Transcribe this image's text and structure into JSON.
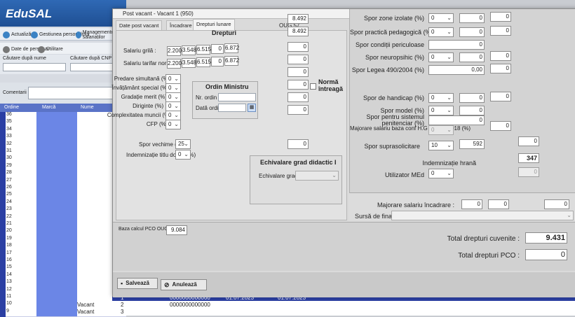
{
  "app": {
    "logo": "EduSAL",
    "nav": [
      "Actualizări",
      "Gestiunea personalului",
      "Managementul salariaților"
    ],
    "row2": [
      "Date de personal",
      "Utilitare"
    ],
    "search_name_label": "Căutare după nume",
    "search_cnp_label": "Căutare după CNP",
    "comments_label": "Comentarii",
    "grid_headers": [
      "Ordine",
      "Marcă",
      "Nume"
    ],
    "grid_rows": [
      "36",
      "35",
      "34",
      "33",
      "32",
      "31",
      "30",
      "29",
      "28",
      "27",
      "26",
      "25",
      "24",
      "23",
      "22",
      "21",
      "20",
      "19",
      "18",
      "17",
      "16",
      "15",
      "14",
      "13",
      "12",
      "11",
      "10",
      "9"
    ],
    "bottom_rows": [
      {
        "status": "Vacant",
        "nr": "1",
        "code": "0000000000000",
        "date": "01.07.2023",
        "date2": "01.07.2023"
      },
      {
        "status": "Vacant",
        "nr": "2",
        "code": "0000000000000",
        "date": "",
        "date2": ""
      },
      {
        "status": "Vacant",
        "nr": "3",
        "code": "",
        "date": "",
        "date2": ""
      }
    ]
  },
  "modal": {
    "title": "Post vacant - Vacant 1 (950)",
    "tabs": [
      "Date post vacant",
      "Încadrare",
      "Drepturi lunare"
    ],
    "drepturi_header": "Drepturi",
    "oug_header": "OUG 57",
    "oug_values": [
      "8.492",
      "8.492"
    ],
    "salariu_grila_label": "Salariu grilă :",
    "salariu_grila_values": [
      "2.200",
      "3.548",
      "6.515",
      "0",
      "6.872"
    ],
    "salariu_tarifar_label": "Salariu tarifar normat :",
    "salariu_tarifar_values": [
      "2.200",
      "3.548",
      "6.515",
      "0",
      "6.872"
    ],
    "left_fields": [
      {
        "label": "Predare simultană (%)",
        "value": "0"
      },
      {
        "label": "Învățământ special (%)",
        "value": "0"
      },
      {
        "label": "Gradație merit (%)",
        "value": "0"
      },
      {
        "label": "Diriginte (%)",
        "value": "0"
      },
      {
        "label": "Complexitatea muncii (%)",
        "value": "0"
      },
      {
        "label": "CFP (%)",
        "value": "0"
      }
    ],
    "oug_small_values": [
      "0",
      "0",
      "0",
      "0",
      "0",
      "0",
      "0",
      "0"
    ],
    "norma_label": "Normă întreagă",
    "ordin_title": "Ordin Ministru",
    "nr_ordin_label": "Nr. ordin",
    "data_ordin_label": "Dată ordin",
    "spor_vechime_label": "Spor vechime (%)",
    "spor_vechime_value": "25",
    "spor_vechime_oug": "0",
    "indemnizatie_doctor_label": "Indemnizație titlu doctor (%)",
    "indemnizatie_doctor_value": "0",
    "echivalare_title": "Echivalare grad didactic I",
    "echivalare_label": "Echivalare grad",
    "baza_calcul_label": "Baza calcul PCO OUG 57 :",
    "baza_calcul_value": "9.084",
    "right_fields": [
      {
        "label": "Spor zone izolate (%)",
        "sel": "0",
        "v1": "0",
        "v2": "0"
      },
      {
        "label": "Spor practică pedagogică (%)",
        "sel": "0",
        "v1": "0",
        "v2": "0"
      },
      {
        "label": "Spor condiții periculoase",
        "sel": "",
        "v1": "0",
        "v2": ""
      },
      {
        "label": "Spor neuropsihic (%)",
        "sel": "0",
        "v1": "0",
        "v2": "0"
      },
      {
        "label": "Spor Legea 490/2004 (%)",
        "sel": "",
        "v1": "0,00",
        "v2": "0"
      },
      {
        "label": "Spor de handicap (%)",
        "sel": "0",
        "v1": "0",
        "v2": "0"
      },
      {
        "label": "Spor model (%)",
        "sel": "0",
        "v1": "0",
        "v2": ""
      },
      {
        "label": "Spor pentru sistemul penitenciar (%)",
        "sel": "",
        "v1": "0",
        "v2": ""
      }
    ],
    "majorare_hg_label": "Majorare salariu baza conf H.G nr. 325/2018 (%)",
    "majorare_hg_sel": "0",
    "majorare_hg_val": "0",
    "spor_suprasolicitare_label": "Spor suprasolicitare",
    "spor_suprasolicitare_sel": "10",
    "spor_suprasolicitare_val": "592",
    "spor_suprasolicitare_oug": "0",
    "indemnizatie_hrana_label": "Indemnizație hrană",
    "indemnizatie_hrana_value": "347",
    "utilizator_med_label": "Utilizator MEd",
    "utilizator_med_sel": "0",
    "utilizator_med_val": "0",
    "majorare_incadrare_label": "Majorare salariu încadrare :",
    "majorare_incadrare_values": [
      "0",
      "0",
      "0"
    ],
    "sursa_label": "Sursă de finanțare:",
    "total_cuvenite_label": "Total drepturi cuvenite :",
    "total_cuvenite_value": "9.431",
    "total_pco_label": "Total drepturi PCO :",
    "total_pco_value": "0",
    "save_label": "Salvează",
    "cancel_label": "Anulează"
  },
  "colors": {
    "accent": "#1f4f93",
    "grid_header": "#5a73c7",
    "selection": "#2b3fa3"
  }
}
